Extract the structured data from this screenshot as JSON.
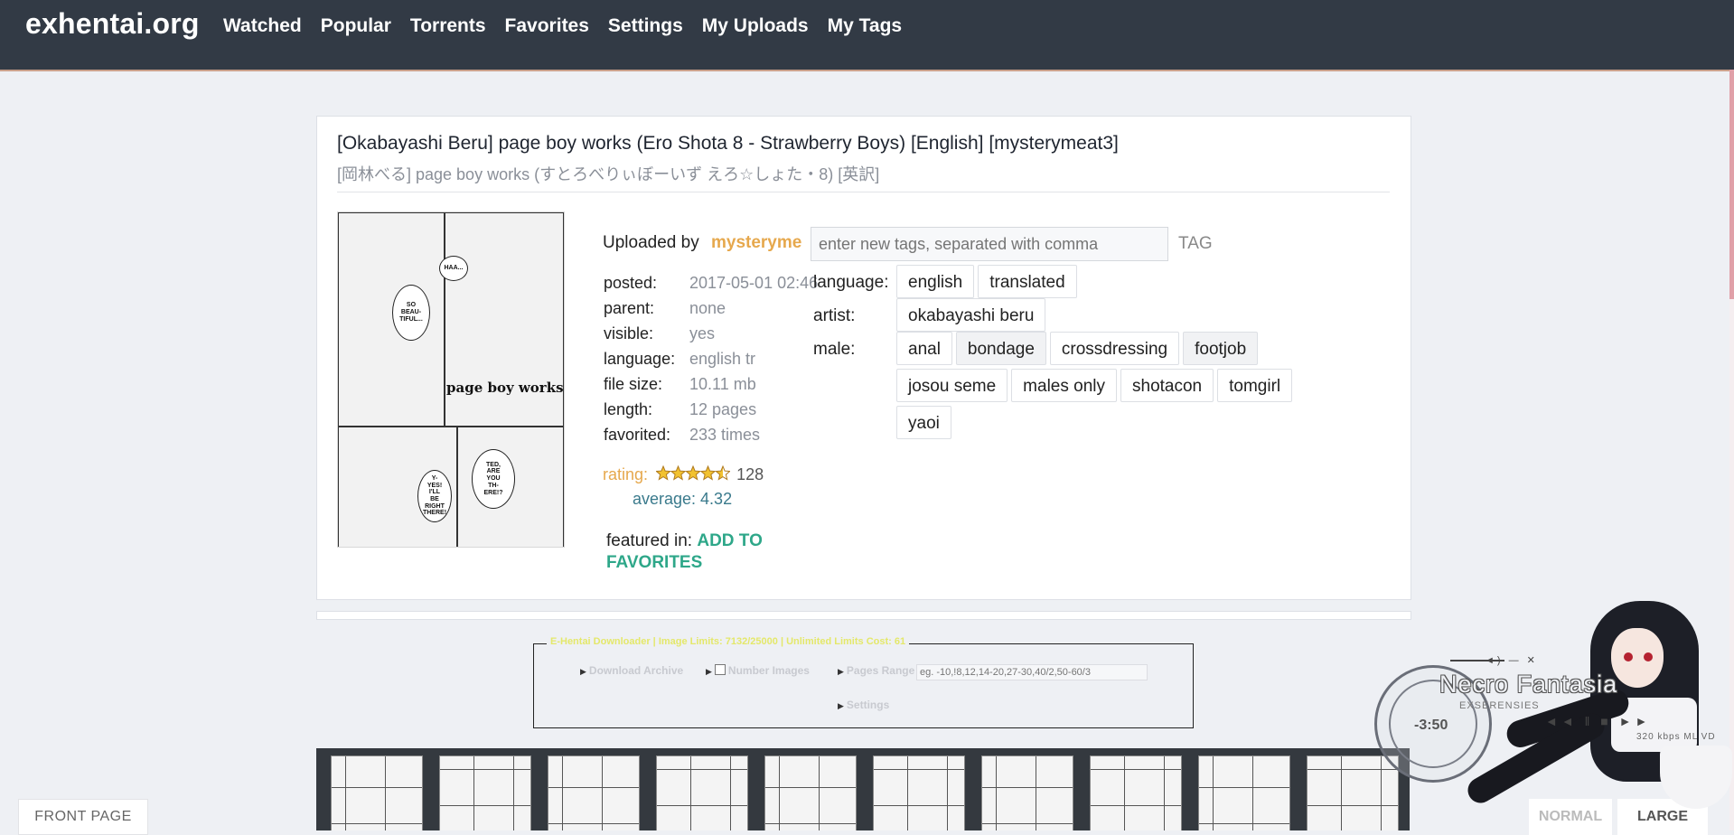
{
  "nav": {
    "brand": "exhentai.org",
    "links": [
      "Watched",
      "Popular",
      "Torrents",
      "Favorites",
      "Settings",
      "My Uploads",
      "My Tags"
    ]
  },
  "gallery": {
    "title": "[Okabayashi Beru] page boy works (Ero Shota 8 - Strawberry Boys) [English] [mysterymeat3]",
    "title_jp": "[岡林べる] page boy works (すとろべりぃぼーいず えろ☆しょた・8) [英訳]",
    "cover_title": "page boy works",
    "uploaded_by_label": "Uploaded by",
    "uploader": "mysteryme",
    "meta": [
      {
        "key": "posted:",
        "value": "2017-05-01 02:46"
      },
      {
        "key": "parent:",
        "value": "none"
      },
      {
        "key": "visible:",
        "value": "yes"
      },
      {
        "key": "language:",
        "value": "english  tr"
      },
      {
        "key": "file size:",
        "value": "10.11 mb"
      },
      {
        "key": "length:",
        "value": "12 pages"
      },
      {
        "key": "favorited:",
        "value": "233 times"
      }
    ],
    "rating_label": "rating:",
    "rating_count": "128",
    "rating_stars": 4.5,
    "average": "average: 4.32",
    "featured_label": "featured in:",
    "add_to_favorites": "ADD TO FAVORITES"
  },
  "tag_editor": {
    "placeholder": "enter new tags, separated with comma",
    "button": "TAG"
  },
  "tags": [
    {
      "namespace": "language:",
      "values": [
        "english",
        "translated"
      ]
    },
    {
      "namespace": "artist:",
      "values": [
        "okabayashi beru"
      ]
    },
    {
      "namespace": "male:",
      "values": [
        "anal",
        "bondage",
        "crossdressing",
        "footjob",
        "josou seme",
        "males only",
        "shotacon",
        "tomgirl",
        "yaoi"
      ]
    }
  ],
  "downloader": {
    "legend": "E-Hentai Downloader | Image Limits: 7132/25000 | Unlimited Limits Cost: 61",
    "download_archive": "Download Archive",
    "number_images": "Number Images",
    "pages_range": "Pages Range",
    "pages_range_placeholder": "eg. -10,!8,12,14-20,27-30,40/2,50-60/3",
    "settings": "Settings"
  },
  "thumbnails_count": 10,
  "footer": {
    "front_page": "FRONT PAGE",
    "normal": "NORMAL",
    "large": "LARGE"
  },
  "media_widget": {
    "title": "Necro Fantasia",
    "subtitle": "EXSERENSIES",
    "time": "-3:50",
    "meta": "320 kbps  ML  VD"
  },
  "colors": {
    "topbar": "#323a45",
    "uploader": "#e6a84d",
    "add_favorites": "#2ea789",
    "average": "#3a7a8c",
    "legend": "#e4e86a"
  }
}
